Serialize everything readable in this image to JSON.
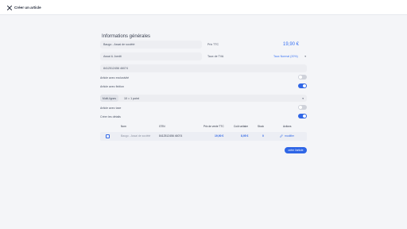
{
  "header": {
    "title": "Créer un article",
    "close_icon": "close-icon"
  },
  "general": {
    "section_title": "Informations générales",
    "name_field": "Baugo - Assai de société",
    "brand_field": "Assai & Joedti",
    "barcode_field": "8412512456 46074",
    "price_label": "Prix TTC",
    "price_value": "19,90 €",
    "tva_label": "Taux de TVA",
    "tva_value": "Taux Normal (20%)"
  },
  "options": {
    "exclusive_label": "Article avec exclusivité",
    "exclusive_on": false,
    "finish_label": "Article avec finition",
    "finish_on": true,
    "points_pill": "Multi-lignes",
    "points_value": "10 = 1 point",
    "tax_label": "Article avec taxe",
    "tax_on": false,
    "details_label": "Créer les détails",
    "details_on": true
  },
  "table": {
    "headers": [
      "Nom",
      "GTIN",
      "Prix de vente TTC",
      "Coût unitaire",
      "Stock",
      "Actions"
    ],
    "row": {
      "name": "Baugo - Assai de société",
      "gtin": "8412512456 46074",
      "price": "19,90 €",
      "cost": "8,95 €",
      "stock": "0",
      "action": "modifier",
      "action_icon": "pencil-icon"
    }
  },
  "footer": {
    "add_button": "créer l'article"
  },
  "colors": {
    "accent": "#2f66e6",
    "background": "#f4f5f8",
    "field": "#edeef2"
  }
}
